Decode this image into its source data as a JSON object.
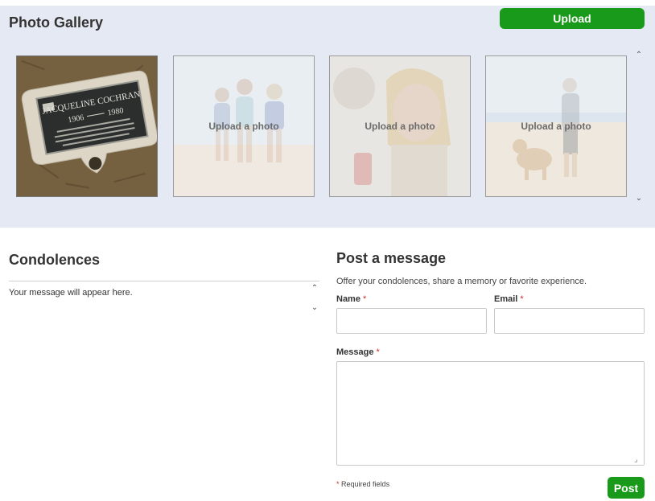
{
  "gallery": {
    "title": "Photo Gallery",
    "upload_label": "Upload",
    "photos": [
      {
        "kind": "headstone",
        "plaque_name": "JACQUELINE COCHRAN",
        "plaque_years_left": "1906",
        "plaque_years_right": "1980"
      },
      {
        "kind": "placeholder",
        "label": "Upload a photo",
        "icon": "beach-family-illustration"
      },
      {
        "kind": "placeholder",
        "label": "Upload a photo",
        "icon": "smiling-woman-illustration"
      },
      {
        "kind": "placeholder",
        "label": "Upload a photo",
        "icon": "man-with-dog-beach-illustration"
      }
    ],
    "scroll_up_icon": "chevron-up-icon",
    "scroll_down_icon": "chevron-down-icon"
  },
  "condolences": {
    "title": "Condolences",
    "empty_text": "Your message will appear here."
  },
  "post": {
    "title": "Post a message",
    "subtitle": "Offer your condolences, share a memory or favorite experience.",
    "name_label": "Name",
    "email_label": "Email",
    "message_label": "Message",
    "required_marker": "*",
    "required_note": "Required fields",
    "name_value": "",
    "email_value": "",
    "message_value": "",
    "submit_label": "Post"
  },
  "colors": {
    "accent_green": "#1a9a1a",
    "gallery_bg": "#e5e9f4",
    "required_red": "#d12b2b"
  }
}
